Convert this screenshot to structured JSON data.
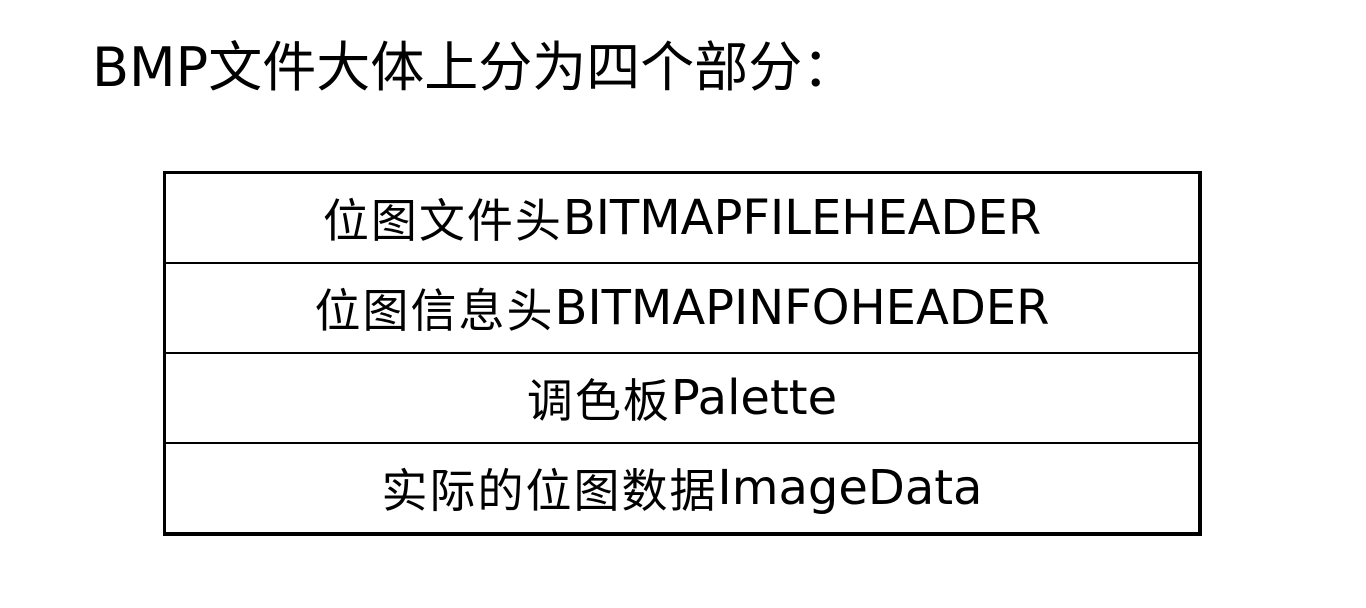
{
  "title": "BMP文件大体上分为四个部分：",
  "parts": [
    {
      "cn": "位图文件头",
      "en": "BITMAPFILEHEADER"
    },
    {
      "cn": "位图信息头",
      "en": "BITMAPINFOHEADER"
    },
    {
      "cn": "调色板",
      "en": "Palette"
    },
    {
      "cn": "实际的位图数据",
      "en": "ImageData"
    }
  ]
}
